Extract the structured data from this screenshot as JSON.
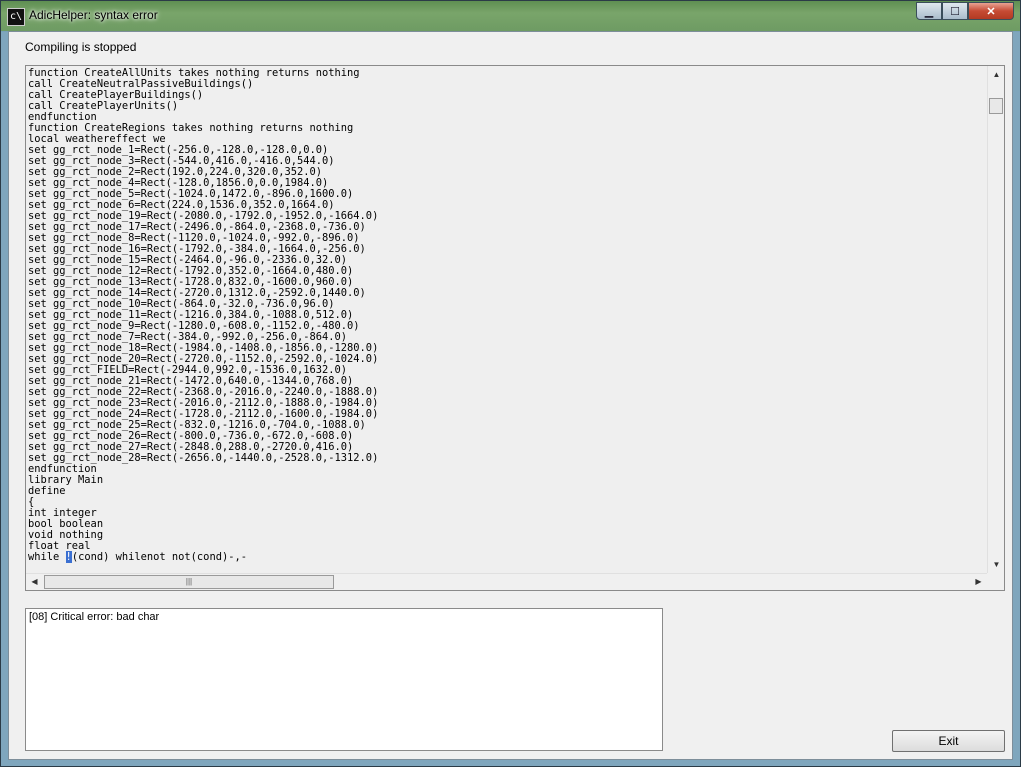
{
  "window": {
    "icon_text": "c\\",
    "title": "AdicHelper: syntax error",
    "buttons": {
      "minimize": "▁",
      "maximize": "☐",
      "close": "✕"
    }
  },
  "status": {
    "text": "Compiling is stopped"
  },
  "code": {
    "lines": [
      "function CreateAllUnits takes nothing returns nothing",
      "call CreateNeutralPassiveBuildings()",
      "call CreatePlayerBuildings()",
      "call CreatePlayerUnits()",
      "endfunction",
      "function CreateRegions takes nothing returns nothing",
      "local weathereffect we",
      "set gg_rct_node_1=Rect(-256.0,-128.0,-128.0,0.0)",
      "set gg_rct_node_3=Rect(-544.0,416.0,-416.0,544.0)",
      "set gg_rct_node_2=Rect(192.0,224.0,320.0,352.0)",
      "set gg_rct_node_4=Rect(-128.0,1856.0,0.0,1984.0)",
      "set gg_rct_node_5=Rect(-1024.0,1472.0,-896.0,1600.0)",
      "set gg_rct_node_6=Rect(224.0,1536.0,352.0,1664.0)",
      "set gg_rct_node_19=Rect(-2080.0,-1792.0,-1952.0,-1664.0)",
      "set gg_rct_node_17=Rect(-2496.0,-864.0,-2368.0,-736.0)",
      "set gg_rct_node_8=Rect(-1120.0,-1024.0,-992.0,-896.0)",
      "set gg_rct_node_16=Rect(-1792.0,-384.0,-1664.0,-256.0)",
      "set gg_rct_node_15=Rect(-2464.0,-96.0,-2336.0,32.0)",
      "set gg_rct_node_12=Rect(-1792.0,352.0,-1664.0,480.0)",
      "set gg_rct_node_13=Rect(-1728.0,832.0,-1600.0,960.0)",
      "set gg_rct_node_14=Rect(-2720.0,1312.0,-2592.0,1440.0)",
      "set gg_rct_node_10=Rect(-864.0,-32.0,-736.0,96.0)",
      "set gg_rct_node_11=Rect(-1216.0,384.0,-1088.0,512.0)",
      "set gg_rct_node_9=Rect(-1280.0,-608.0,-1152.0,-480.0)",
      "set gg_rct_node_7=Rect(-384.0,-992.0,-256.0,-864.0)",
      "set gg_rct_node_18=Rect(-1984.0,-1408.0,-1856.0,-1280.0)",
      "set gg_rct_node_20=Rect(-2720.0,-1152.0,-2592.0,-1024.0)",
      "set gg_rct_FIELD=Rect(-2944.0,992.0,-1536.0,1632.0)",
      "set gg_rct_node_21=Rect(-1472.0,640.0,-1344.0,768.0)",
      "set gg_rct_node_22=Rect(-2368.0,-2016.0,-2240.0,-1888.0)",
      "set gg_rct_node_23=Rect(-2016.0,-2112.0,-1888.0,-1984.0)",
      "set gg_rct_node_24=Rect(-1728.0,-2112.0,-1600.0,-1984.0)",
      "set gg_rct_node_25=Rect(-832.0,-1216.0,-704.0,-1088.0)",
      "set gg_rct_node_26=Rect(-800.0,-736.0,-672.0,-608.0)",
      "set gg_rct_node_27=Rect(-2848.0,288.0,-2720.0,416.0)",
      "set gg_rct_node_28=Rect(-2656.0,-1440.0,-2528.0,-1312.0)",
      "endfunction",
      "library Main",
      "define",
      "{",
      "int integer",
      "bool boolean",
      "void nothing",
      "float real"
    ],
    "last_line": {
      "before": "while ",
      "highlighted": "!",
      "after": "(cond) whilenot not(cond)-,-"
    }
  },
  "scrollbars": {
    "up": "▲",
    "down": "▼",
    "left": "◀",
    "right": "▶",
    "grip": "|||"
  },
  "error": {
    "text": "[08] Critical error: bad char"
  },
  "exit_button": {
    "label": "Exit"
  },
  "colors": {
    "selection": "#3a6fd1",
    "close_button": "#c64b34"
  }
}
